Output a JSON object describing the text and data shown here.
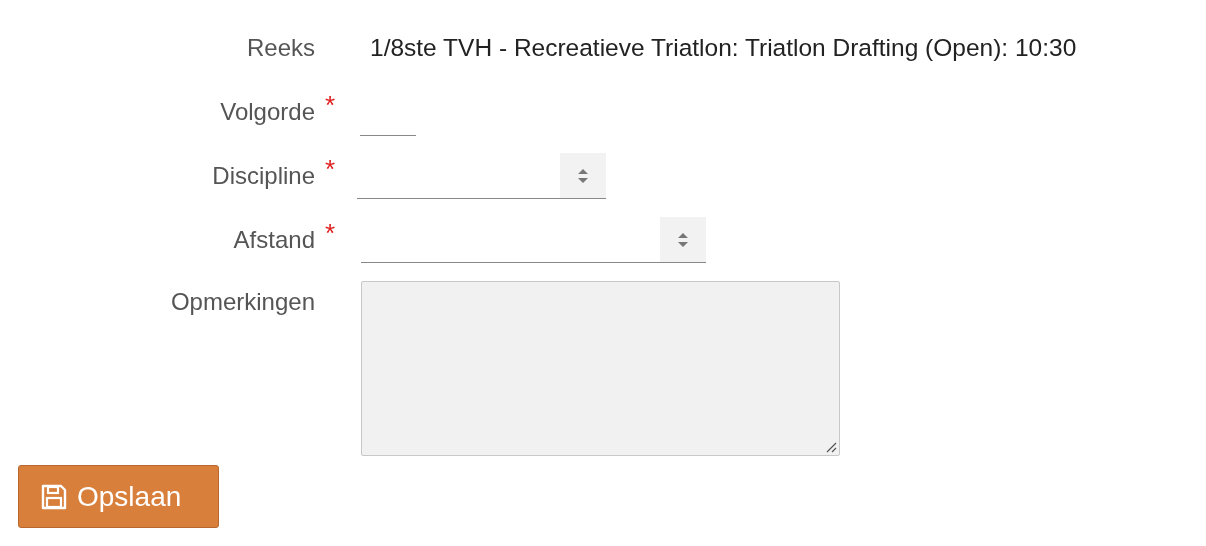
{
  "required_mark": "*",
  "fields": [
    {
      "label": "Reeks",
      "kind": "static",
      "required": false,
      "value": "1/8ste TVH - Recreatieve Triatlon: Triatlon Drafting (Open): 10:30"
    },
    {
      "label": "Volgorde",
      "kind": "short-input",
      "required": true
    },
    {
      "label": "Discipline",
      "kind": "select",
      "required": true
    },
    {
      "label": "Afstand",
      "kind": "wideselect",
      "required": true
    },
    {
      "label": "Opmerkingen",
      "kind": "textarea",
      "required": false
    }
  ],
  "button": {
    "label": "Opslaan"
  }
}
